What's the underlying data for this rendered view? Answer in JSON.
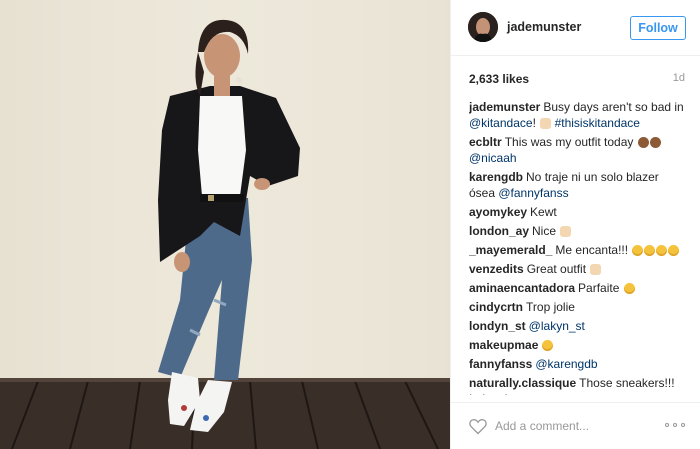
{
  "post": {
    "image_alt": "Woman in black blazer, white t-shirt and jeans standing against a cream wall on a wooden deck",
    "colors": {
      "wall": "#ebe6d8",
      "deck": "#3a2e28",
      "blazer": "#17171a",
      "denim": "#4e6a8a"
    }
  },
  "header": {
    "username": "jademunster",
    "follow_label": "Follow",
    "accent": "#3897f0"
  },
  "stats": {
    "likes": "2,633 likes",
    "time": "1d"
  },
  "comments": [
    {
      "author": "jademunster",
      "parts": [
        {
          "t": "Busy days aren't so bad in "
        },
        {
          "m": "@kitandace"
        },
        {
          "t": "! "
        },
        {
          "e": "hand"
        },
        {
          "t": " "
        },
        {
          "m": "#thisiskitandace"
        }
      ]
    },
    {
      "author": "ecbltr",
      "parts": [
        {
          "t": "This was my outfit today "
        },
        {
          "e": "monkey"
        },
        {
          "e": "monkey"
        },
        {
          "t": " "
        },
        {
          "m": "@nicaah"
        }
      ]
    },
    {
      "author": "karengdb",
      "parts": [
        {
          "t": "No traje ni un solo blazer ósea "
        },
        {
          "m": "@fannyfanss"
        }
      ]
    },
    {
      "author": "ayomykey",
      "parts": [
        {
          "t": "Kewt"
        }
      ]
    },
    {
      "author": "london_ay",
      "parts": [
        {
          "t": "Nice "
        },
        {
          "e": "hand"
        }
      ]
    },
    {
      "author": "_mayemerald_",
      "parts": [
        {
          "t": "Me encanta!!! "
        },
        {
          "e": "smile"
        },
        {
          "e": "smile"
        },
        {
          "e": "smile"
        },
        {
          "e": "smile"
        }
      ]
    },
    {
      "author": "venzedits",
      "parts": [
        {
          "t": "Great outfit "
        },
        {
          "e": "hand"
        }
      ]
    },
    {
      "author": "aminaencantadora",
      "parts": [
        {
          "t": "Parfaite "
        },
        {
          "e": "smile"
        }
      ]
    },
    {
      "author": "cindycrtn",
      "parts": [
        {
          "t": "Trop jolie"
        }
      ]
    },
    {
      "author": "londyn_st",
      "parts": [
        {
          "m": "@lakyn_st"
        }
      ]
    },
    {
      "author": "makeupmae",
      "parts": [
        {
          "e": "smile"
        }
      ]
    },
    {
      "author": "fannyfanss",
      "parts": [
        {
          "m": "@karengdb"
        }
      ]
    },
    {
      "author": "naturally.classique",
      "parts": [
        {
          "t": "Those sneakers!!! In love!"
        }
      ]
    }
  ],
  "footer": {
    "comment_placeholder": "Add a comment...",
    "like_icon": "heart-outline-icon",
    "more_icon": "more-options-icon"
  }
}
